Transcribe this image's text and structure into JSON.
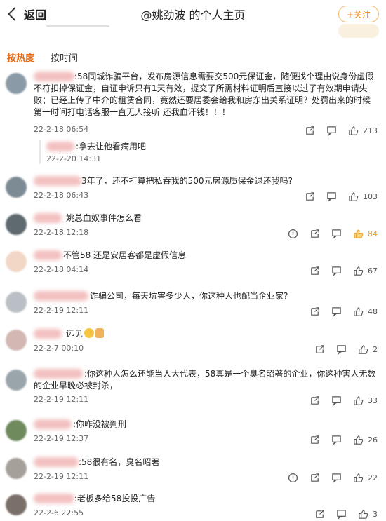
{
  "header": {
    "back_label": "返回",
    "title": "@姚劲波 的个人主页",
    "follow_label": "+关注"
  },
  "tabs": [
    {
      "label": "按热度",
      "active": true
    },
    {
      "label": "按时间",
      "active": false
    }
  ],
  "comments": [
    {
      "text": ":58同城诈骗平台，发布房源信息需要交500元保证金，随便找个理由说身份虚假不符扣掉保证金，自证申诉只有1天有效，提交了所需材料证明后直接以过了有效期申请失败；已经上传了中介的租赁合同，竟然还要居委会给我和房东出关系证明？处罚出来的时候第一时间打电话客服一直无人接听  还我血汗钱！！！",
      "time": "22-2-18 06:54",
      "likes": "213",
      "reply": {
        "text": ":拿去让他看病用吧",
        "time": "22-2-20 14:31"
      }
    },
    {
      "text": "3年了，还不打算把私吞我的500元房源质保金退还我吗?",
      "time": "22-2-18 06:43",
      "likes": "103"
    },
    {
      "text": "姚总血奴事件怎么看",
      "time": "22-2-18 12:18",
      "likes": "84"
    },
    {
      "text": "不管58 还是安居客都是虚假信息",
      "time": "22-2-18 04:14",
      "likes": "67"
    },
    {
      "text": "诈骗公司，每天坑害多少人，你这种人也配当企业家?",
      "time": "22-2-19 12:11",
      "likes": "48"
    },
    {
      "text": "远见",
      "time": "22-2-7 00:10",
      "likes": "2"
    },
    {
      "text": ":你这种人怎么还能当人大代表，58真是一个臭名昭著的企业，你这种害人无数的企业早晚必被封杀，",
      "time": "22-2-19 12:11",
      "likes": "33"
    },
    {
      "text": ":你咋没被判刑",
      "time": "22-2-19 12:37",
      "likes": "26"
    },
    {
      "text": ":58很有名，臭名昭著",
      "time": "22-2-19 12:11",
      "likes": "22"
    },
    {
      "text": ":老板多给58投投广告",
      "time": "22-2-6 22:55",
      "likes": "3"
    }
  ],
  "icons": {
    "share": "share-icon",
    "comment": "comment-icon",
    "like": "thumbs-up-icon",
    "report": "report-icon"
  },
  "colors": {
    "accent": "#e26a17",
    "follow": "#e88a1a",
    "hot_like": "#f0a020"
  }
}
